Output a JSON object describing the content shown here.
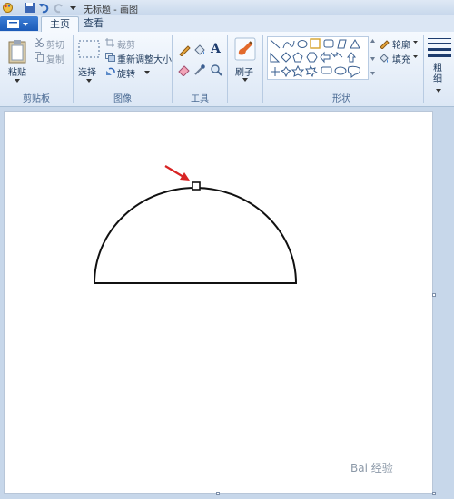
{
  "window": {
    "title": "无标题 - 画图"
  },
  "tabs": [
    "主页",
    "查看"
  ],
  "ribbon": {
    "clipboard": {
      "paste": "粘贴",
      "cut": "剪切",
      "copy": "复制",
      "label": "剪贴板"
    },
    "image": {
      "select": "选择",
      "crop": "裁剪",
      "resize": "重新调整大小",
      "rotate": "旋转",
      "label": "图像"
    },
    "tools": {
      "text_icon": "A",
      "label": "工具"
    },
    "brushes": {
      "label": "刷子"
    },
    "shapes": {
      "outline": "轮廓",
      "fill": "填充",
      "label": "形状"
    },
    "size": {
      "label": "粗细"
    }
  },
  "watermark": "Bai 经验",
  "colors": {
    "arrow": "#d82424",
    "accent": "#1c5bb8"
  }
}
